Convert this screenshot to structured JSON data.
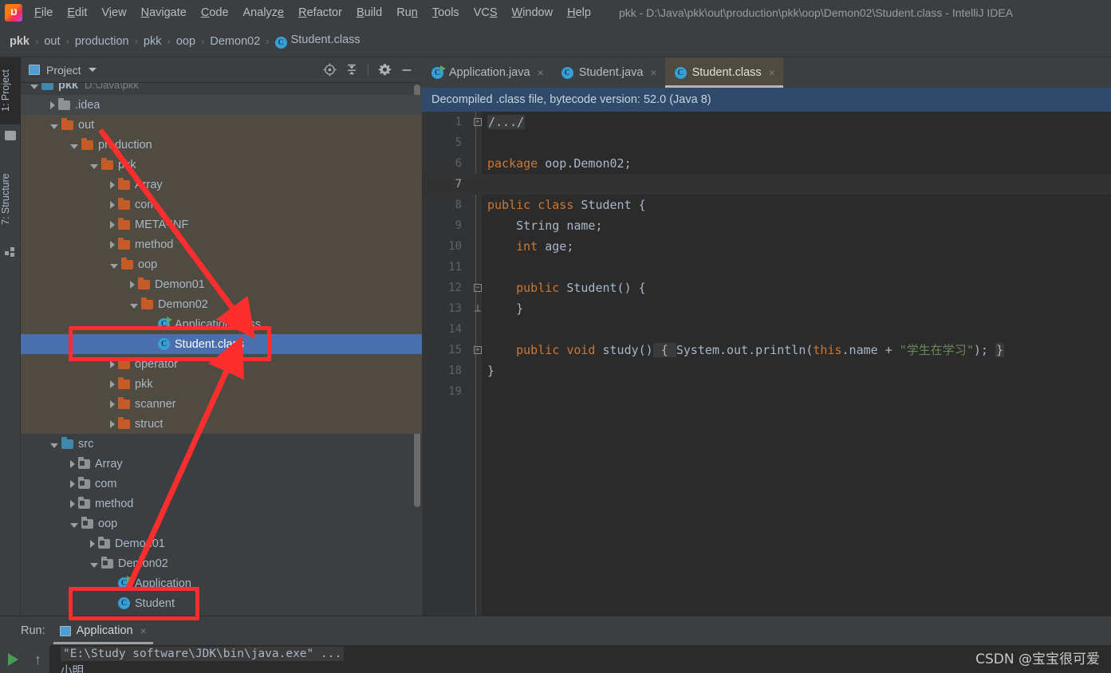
{
  "window": {
    "logo_text": "IJ",
    "title": "pkk - D:\\Java\\pkk\\out\\production\\pkk\\oop\\Demon02\\Student.class - IntelliJ IDEA",
    "menu": [
      "File",
      "Edit",
      "View",
      "Navigate",
      "Code",
      "Analyze",
      "Refactor",
      "Build",
      "Run",
      "Tools",
      "VCS",
      "Window",
      "Help"
    ]
  },
  "breadcrumb": {
    "items": [
      "pkk",
      "out",
      "production",
      "pkk",
      "oop",
      "Demon02",
      "Student.class"
    ],
    "separator": "›",
    "class_badge": "C"
  },
  "left_strip": {
    "project_tab": "1: Project",
    "structure_tab": "7: Structure"
  },
  "project_panel": {
    "title": "Project",
    "tools": [
      {
        "name": "locate-icon",
        "label": "Select Opened File"
      },
      {
        "name": "collapse-all-icon",
        "label": "Collapse All"
      },
      {
        "name": "gear-icon",
        "label": "Settings"
      },
      {
        "name": "minimize-icon",
        "label": "Hide"
      }
    ],
    "tree": [
      {
        "label": "pkk",
        "path": "D:\\Java\\pkk",
        "indent": 0,
        "arrow": "open",
        "icon": "module",
        "state": "normal",
        "bold": true
      },
      {
        "label": ".idea",
        "path": "",
        "indent": 1,
        "arrow": "closed",
        "icon": "folder-grey",
        "state": "hover",
        "bold": false
      },
      {
        "label": "out",
        "path": "",
        "indent": 1,
        "arrow": "open",
        "icon": "folder-orange",
        "state": "excluded",
        "bold": false
      },
      {
        "label": "production",
        "path": "",
        "indent": 2,
        "arrow": "open",
        "icon": "folder-orange",
        "state": "excluded",
        "bold": false
      },
      {
        "label": "pkk",
        "path": "",
        "indent": 3,
        "arrow": "open",
        "icon": "folder-orange",
        "state": "excluded",
        "bold": false
      },
      {
        "label": "Array",
        "path": "",
        "indent": 4,
        "arrow": "closed",
        "icon": "folder-orange",
        "state": "excluded",
        "bold": false
      },
      {
        "label": "com",
        "path": "",
        "indent": 4,
        "arrow": "closed",
        "icon": "folder-orange",
        "state": "excluded",
        "bold": false
      },
      {
        "label": "META-INF",
        "path": "",
        "indent": 4,
        "arrow": "closed",
        "icon": "folder-orange",
        "state": "excluded",
        "bold": false
      },
      {
        "label": "method",
        "path": "",
        "indent": 4,
        "arrow": "closed",
        "icon": "folder-orange",
        "state": "excluded",
        "bold": false
      },
      {
        "label": "oop",
        "path": "",
        "indent": 4,
        "arrow": "open",
        "icon": "folder-orange",
        "state": "excluded",
        "bold": false
      },
      {
        "label": "Demon01",
        "path": "",
        "indent": 5,
        "arrow": "closed",
        "icon": "folder-orange",
        "state": "excluded",
        "bold": false
      },
      {
        "label": "Demon02",
        "path": "",
        "indent": 5,
        "arrow": "open",
        "icon": "folder-orange",
        "state": "excluded",
        "bold": false
      },
      {
        "label": "Application.class",
        "path": "",
        "indent": 6,
        "arrow": "none",
        "icon": "class-runnable",
        "state": "excluded",
        "bold": false
      },
      {
        "label": "Student.class",
        "path": "",
        "indent": 6,
        "arrow": "none",
        "icon": "class",
        "state": "selected",
        "bold": false
      },
      {
        "label": "operator",
        "path": "",
        "indent": 4,
        "arrow": "closed",
        "icon": "folder-orange",
        "state": "excluded",
        "bold": false
      },
      {
        "label": "pkk",
        "path": "",
        "indent": 4,
        "arrow": "closed",
        "icon": "folder-orange",
        "state": "excluded",
        "bold": false
      },
      {
        "label": "scanner",
        "path": "",
        "indent": 4,
        "arrow": "closed",
        "icon": "folder-orange",
        "state": "excluded",
        "bold": false
      },
      {
        "label": "struct",
        "path": "",
        "indent": 4,
        "arrow": "closed",
        "icon": "folder-orange",
        "state": "excluded",
        "bold": false
      },
      {
        "label": "src",
        "path": "",
        "indent": 1,
        "arrow": "open",
        "icon": "folder-source",
        "state": "normal",
        "bold": false
      },
      {
        "label": "Array",
        "path": "",
        "indent": 2,
        "arrow": "closed",
        "icon": "package",
        "state": "normal",
        "bold": false
      },
      {
        "label": "com",
        "path": "",
        "indent": 2,
        "arrow": "closed",
        "icon": "package",
        "state": "normal",
        "bold": false
      },
      {
        "label": "method",
        "path": "",
        "indent": 2,
        "arrow": "closed",
        "icon": "package",
        "state": "normal",
        "bold": false
      },
      {
        "label": "oop",
        "path": "",
        "indent": 2,
        "arrow": "open",
        "icon": "package",
        "state": "normal",
        "bold": false
      },
      {
        "label": "Demon01",
        "path": "",
        "indent": 3,
        "arrow": "closed",
        "icon": "package",
        "state": "normal",
        "bold": false
      },
      {
        "label": "Demon02",
        "path": "",
        "indent": 3,
        "arrow": "open",
        "icon": "package",
        "state": "normal",
        "bold": false
      },
      {
        "label": "Application",
        "path": "",
        "indent": 4,
        "arrow": "none",
        "icon": "class-runnable",
        "state": "normal",
        "bold": false
      },
      {
        "label": "Student",
        "path": "",
        "indent": 4,
        "arrow": "none",
        "icon": "class",
        "state": "normal",
        "bold": false
      }
    ]
  },
  "editor": {
    "tabs": [
      {
        "label": "Application.java",
        "icon": "class-runnable",
        "active": false,
        "close": "×"
      },
      {
        "label": "Student.java",
        "icon": "class",
        "active": false,
        "close": "×"
      },
      {
        "label": "Student.class",
        "icon": "class",
        "active": true,
        "close": "×"
      }
    ],
    "notice": "Decompiled .class file, bytecode version: 52.0 (Java 8)",
    "lines": [
      {
        "num": "1",
        "fold": "plus",
        "caret": false,
        "segments": [
          {
            "t": "/.../",
            "c": "n",
            "folded": true
          }
        ]
      },
      {
        "num": "5",
        "fold": "",
        "caret": false,
        "segments": []
      },
      {
        "num": "6",
        "fold": "",
        "caret": false,
        "segments": [
          {
            "t": "package ",
            "c": "k"
          },
          {
            "t": "oop.Demon02;",
            "c": "n"
          }
        ]
      },
      {
        "num": "7",
        "fold": "",
        "caret": true,
        "segments": []
      },
      {
        "num": "8",
        "fold": "",
        "caret": false,
        "segments": [
          {
            "t": "public class ",
            "c": "k"
          },
          {
            "t": "Student {",
            "c": "n"
          }
        ]
      },
      {
        "num": "9",
        "fold": "",
        "caret": false,
        "segments": [
          {
            "t": "    String name;",
            "c": "n"
          }
        ]
      },
      {
        "num": "10",
        "fold": "",
        "caret": false,
        "segments": [
          {
            "t": "    ",
            "c": "n"
          },
          {
            "t": "int",
            "c": "k"
          },
          {
            "t": " age;",
            "c": "n"
          }
        ]
      },
      {
        "num": "11",
        "fold": "",
        "caret": false,
        "segments": []
      },
      {
        "num": "12",
        "fold": "minus",
        "caret": false,
        "segments": [
          {
            "t": "    ",
            "c": "n"
          },
          {
            "t": "public ",
            "c": "k"
          },
          {
            "t": "Student() {",
            "c": "n"
          }
        ]
      },
      {
        "num": "13",
        "fold": "end",
        "caret": false,
        "segments": [
          {
            "t": "    }",
            "c": "n"
          }
        ]
      },
      {
        "num": "14",
        "fold": "",
        "caret": false,
        "segments": []
      },
      {
        "num": "15",
        "fold": "plus",
        "caret": false,
        "segments": [
          {
            "t": "    ",
            "c": "n"
          },
          {
            "t": "public void ",
            "c": "k"
          },
          {
            "t": "study()",
            "c": "n"
          },
          {
            "t": " { ",
            "c": "n",
            "folded": true
          },
          {
            "t": "System.out.println(",
            "c": "n"
          },
          {
            "t": "this",
            "c": "k"
          },
          {
            "t": ".name + ",
            "c": "n"
          },
          {
            "t": "\"学生在学习\"",
            "c": "s"
          },
          {
            "t": "); ",
            "c": "n"
          },
          {
            "t": "}",
            "c": "n",
            "folded": true
          }
        ]
      },
      {
        "num": "18",
        "fold": "",
        "caret": false,
        "segments": [
          {
            "t": "}",
            "c": "n"
          }
        ]
      },
      {
        "num": "19",
        "fold": "",
        "caret": false,
        "segments": []
      }
    ]
  },
  "run_panel": {
    "label": "Run:",
    "tab_label": "Application",
    "tab_close": "×",
    "console_line1": "\"E:\\Study software\\JDK\\bin\\java.exe\" ...",
    "console_line2": "小明",
    "play_button": "run-button",
    "up_button": "↑"
  },
  "watermark": "CSDN @宝宝很可爱",
  "colors": {
    "chrome": "#3C3F41",
    "editor_bg": "#2B2B2B",
    "selection_blue": "#4B6EAF",
    "excluded_olive": "#4F4B41",
    "notice_blue": "#2F4A6B",
    "keyword_orange": "#CC7832",
    "string_green": "#6A8759",
    "text_grey": "#A9B7C6",
    "annotation_red": "#FF2E2E",
    "folder_orange": "#C75B28",
    "class_cyan": "#389FD6"
  },
  "annotations": {
    "box_tree_class": "Student.class",
    "box_tree_source": "Student",
    "arrow_1": "points to Student.class in out tree",
    "arrow_2": "points from Student source to Student.class"
  }
}
